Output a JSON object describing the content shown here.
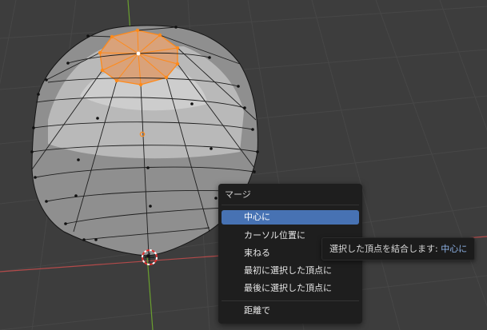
{
  "colors": {
    "background": "#3d3d3d",
    "grid_line": "#474747",
    "x_axis": "#b34a4a",
    "y_axis": "#6a9f2f",
    "mesh_face": "#a9a9a9",
    "mesh_edge": "#202020",
    "selection": "#ff8a1a",
    "menu_bg": "#1e1e1e",
    "menu_highlight": "#4772b3"
  },
  "viewport": {
    "object": "uv-sphere-mesh",
    "selected_vertex_count": 11,
    "cursor_icon": "3d-cursor-icon"
  },
  "merge_menu": {
    "title": "マージ",
    "items": [
      {
        "label": "中心に",
        "active": true
      },
      {
        "label": "カーソル位置に",
        "active": false
      },
      {
        "label": "束ねる",
        "active": false
      },
      {
        "label": "最初に選択した頂点に",
        "active": false
      },
      {
        "label": "最後に選択した頂点に",
        "active": false
      },
      {
        "label": "距離で",
        "active": false
      }
    ]
  },
  "tooltip": {
    "text": "選択した頂点を結合します:",
    "value": "中心に"
  }
}
